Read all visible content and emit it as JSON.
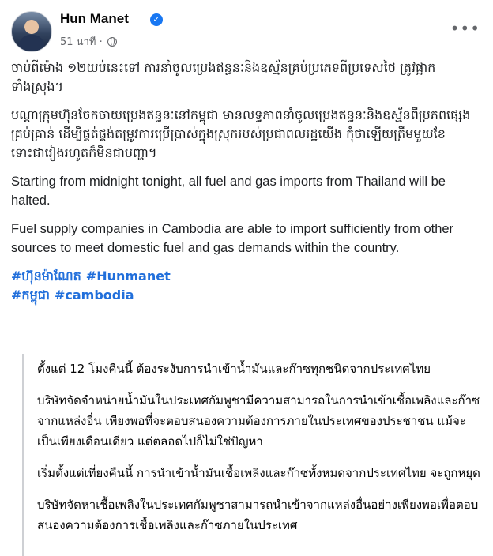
{
  "post": {
    "author": "Hun Manet",
    "time": "51 นาที ·",
    "more_label": "•••"
  },
  "content": {
    "khmer_para_1": "ចាប់ពីម៉ោង ១២យប់នេះទៅ ការនាំចូលប្រេងឥន្ធនៈនិងឧស្ម័នគ្រប់ប្រភេទពីប្រទេសថៃ ត្រូវផ្អាកទាំងស្រុង។",
    "khmer_para_2": "បណ្តាក្រុមហ៊ុនចែកចាយប្រេងឥន្ធនៈនៅកម្ពុជា មានលទ្ធភាពនាំចូលប្រេងឥន្ធនៈនិងឧស្ម័នពីប្រភពផ្សេង គ្រប់គ្រាន់ ដើម្បីផ្គត់ផ្គង់តម្រូវការប្រើប្រាស់ក្នុងស្រុករបស់ប្រជាពលរដ្ឋយើង កុំថាឡើយត្រឹមមួយខែ ទោះជារៀងរហូតក៏មិនជាបញ្ហា។",
    "english_para_1": "Starting from midnight tonight, all fuel and gas imports from Thailand will be halted.",
    "english_para_2": "Fuel supply companies in Cambodia are able to import sufficiently from other sources to meet domestic fuel and gas demands within the country.",
    "hashtags": [
      "#ហ៊ុនម៉ាណែត",
      "#Hunmanet",
      "#កម្ពុជា",
      "#cambodia"
    ]
  },
  "translation": {
    "thai_para_1": "ตั้งแต่ 12 โมงคืนนี้ ต้องระงับการนำเข้าน้ำมันและก๊าซทุกชนิดจากประเทศไทย",
    "thai_para_2": "บริษัทจัดจำหน่ายน้ำมันในประเทศกัมพูชามีความสามารถในการนำเข้าเชื้อเพลิงและก๊าซจากแหล่งอื่น เพียงพอที่จะตอบสนองความต้องการภายในประเทศของประชาชน แม้จะเป็นเพียงเดือนเดียว แต่ตลอดไปก็ไม่ใช่ปัญหา",
    "thai_para_3": "เริ่มตั้งแต่เที่ยงคืนนี้ การนำเข้าน้ำมันเชื้อเพลิงและก๊าซทั้งหมดจากประเทศไทย จะถูกหยุด",
    "thai_para_4": "บริษัทจัดหาเชื้อเพลิงในประเทศกัมพูชาสามารถนำเข้าจากแหล่งอื่นอย่างเพียงพอเพื่อตอบสนองความต้องการเชื้อเพลิงและก๊าซภายในประเทศ"
  },
  "colors": {
    "link": "#216fdb",
    "verified": "#1877f2",
    "meta": "#65676b"
  },
  "icons": {
    "verified": "verified-badge-icon",
    "globe": "globe-icon",
    "more": "more-options-icon"
  }
}
